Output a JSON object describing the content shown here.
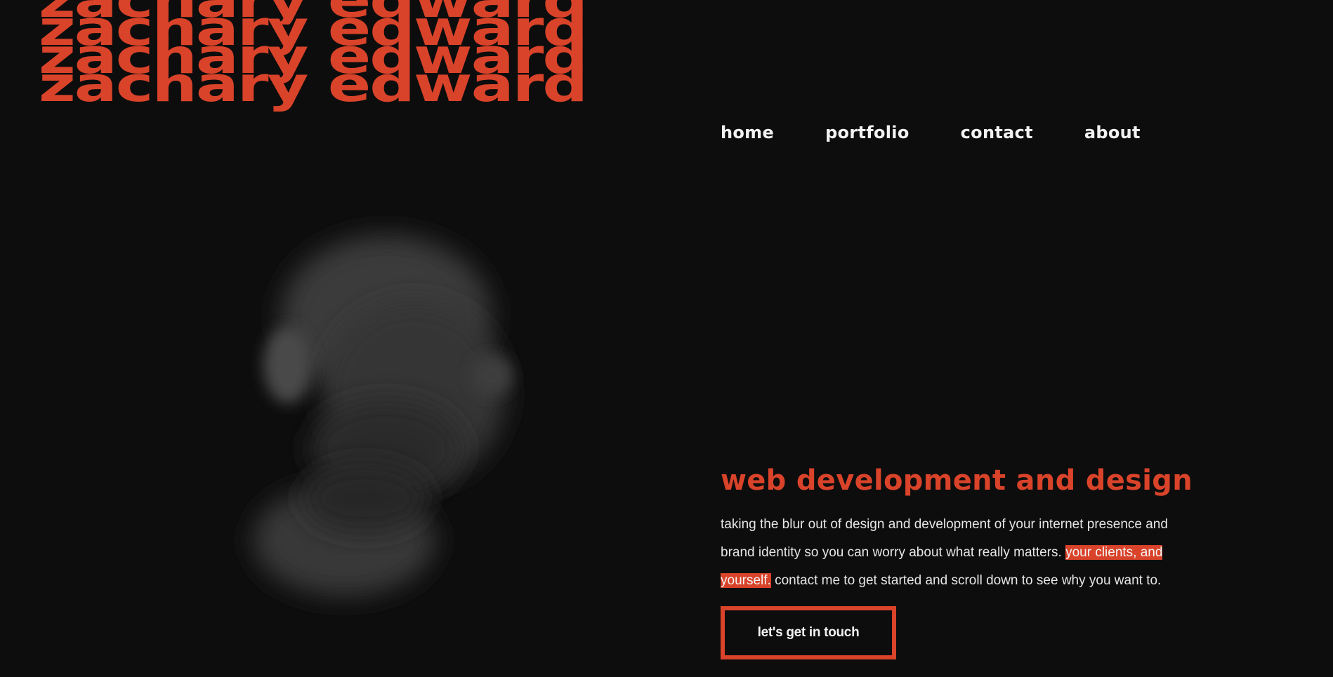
{
  "brand": {
    "name_lines": [
      "zachary edward",
      "zachary edward",
      "zachary edward",
      "zachary edward"
    ],
    "accent_color": "#d9432a",
    "background_color": "#0d0d0d"
  },
  "nav": {
    "items": [
      {
        "label": "home"
      },
      {
        "label": "portfolio"
      },
      {
        "label": "contact"
      },
      {
        "label": "about"
      }
    ]
  },
  "hero": {
    "portrait_description_icon": "blurred-portrait-image",
    "title": "web development and design",
    "desc_part1": "taking the blur out of design and development of your internet presence and brand identity so you can worry about what really matters.",
    "desc_highlight": "your clients, and yourself.",
    "desc_part2": "contact me to get started and scroll down to see why you want to.",
    "cta_label": "let's get in touch"
  }
}
